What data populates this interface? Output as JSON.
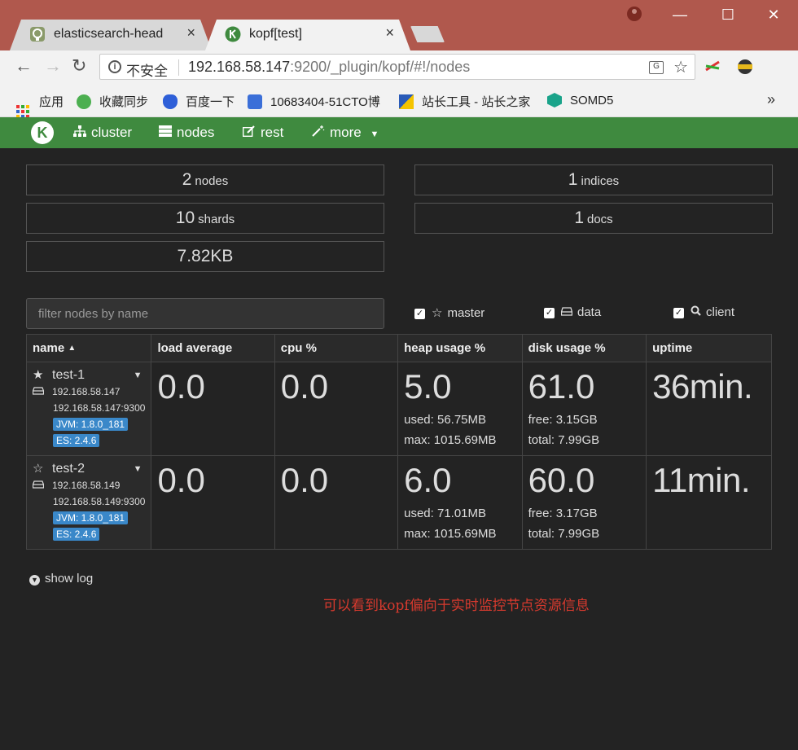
{
  "browser": {
    "tabs": [
      {
        "title": "elasticsearch-head",
        "close": "×"
      },
      {
        "title": "kopf[test]",
        "close": "×"
      }
    ],
    "window_controls": {
      "minimize": "—",
      "maximize": "☐",
      "close": "✕"
    },
    "nav": {
      "back": "←",
      "forward": "→",
      "reload": "↻"
    },
    "omnibox": {
      "security_label": "不安全",
      "url_host": "192.168.58.147",
      "url_path": ":9200/_plugin/kopf/#!/nodes"
    },
    "bookmarks": [
      {
        "label": "应用"
      },
      {
        "label": "收藏同步"
      },
      {
        "label": "百度一下"
      },
      {
        "label": "10683404-51CTO博"
      },
      {
        "label": "站长工具 - 站长之家"
      },
      {
        "label": "SOMD5"
      }
    ],
    "bookmarks_more": "»"
  },
  "navbar": {
    "logo": "K",
    "items": [
      {
        "label": "cluster",
        "icon": "sitemap-icon"
      },
      {
        "label": "nodes",
        "icon": "server-icon"
      },
      {
        "label": "rest",
        "icon": "edit-icon"
      },
      {
        "label": "more",
        "icon": "magic-wand-icon"
      }
    ]
  },
  "stats": {
    "nodes": {
      "value": "2",
      "label": "nodes"
    },
    "indices": {
      "value": "1",
      "label": "indices"
    },
    "shards": {
      "value": "10",
      "label": "shards"
    },
    "docs": {
      "value": "1",
      "label": "docs"
    },
    "size": "7.82KB"
  },
  "filter": {
    "placeholder": "filter nodes by name",
    "master": "master",
    "data": "data",
    "client": "client"
  },
  "table": {
    "headers": [
      "name",
      "load average",
      "cpu %",
      "heap usage %",
      "disk usage %",
      "uptime"
    ],
    "rows": [
      {
        "name": "test-1",
        "role": "master-star-filled",
        "ip": "192.168.58.147",
        "address": "192.168.58.147:9300",
        "jvm": "JVM: 1.8.0_181",
        "es": "ES: 2.4.6",
        "load": "0.0",
        "cpu": "0.0",
        "heap": "5.0",
        "heap_used": "used: 56.75MB",
        "heap_max": "max: 1015.69MB",
        "disk": "61.0",
        "disk_free": "free: 3.15GB",
        "disk_total": "total: 7.99GB",
        "uptime": "36min."
      },
      {
        "name": "test-2",
        "role": "master-star-empty",
        "ip": "192.168.58.149",
        "address": "192.168.58.149:9300",
        "jvm": "JVM: 1.8.0_181",
        "es": "ES: 2.4.6",
        "load": "0.0",
        "cpu": "0.0",
        "heap": "6.0",
        "heap_used": "used: 71.01MB",
        "heap_max": "max: 1015.69MB",
        "disk": "60.0",
        "disk_free": "free: 3.17GB",
        "disk_total": "total: 7.99GB",
        "uptime": "11min."
      }
    ]
  },
  "show_log": "show log",
  "annotation": "可以看到kopf偏向于实时监控节点资源信息",
  "colors": {
    "navbar": "#3f8a3f",
    "background": "#232323",
    "label": "#3a88c9",
    "annotation": "#d83a2e",
    "frame": "#b0584d"
  }
}
